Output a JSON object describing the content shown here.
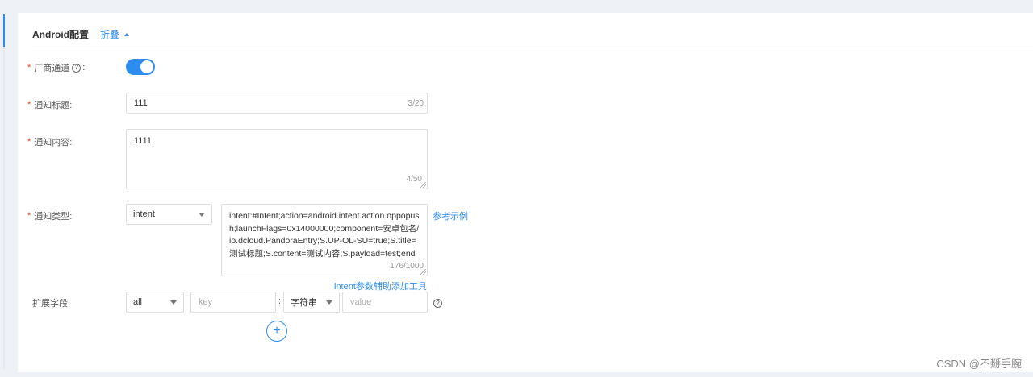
{
  "section": {
    "title": "Android配置",
    "collapse_label": "折叠"
  },
  "fields": {
    "vendor_channel": {
      "label": "厂商通道",
      "help": "?",
      "colon": ":",
      "enabled": true
    },
    "notify_title": {
      "label": "通知标题:",
      "value": "111",
      "counter": "3/20"
    },
    "notify_content": {
      "label": "通知内容:",
      "value": "1111",
      "counter": "4/50"
    },
    "notify_type": {
      "label": "通知类型:",
      "selected": "intent",
      "intent_value": "intent:#Intent;action=android.intent.action.oppopush;launchFlags=0x14000000;component=安卓包名/io.dcloud.PandoraEntry;S.UP-OL-SU=true;S.title=测试标题;S.content=测试内容;S.payload=test;end",
      "counter": "176/1000",
      "example_link": "参考示例",
      "helper_link": "intent参数辅助添加工具"
    },
    "extension": {
      "label": "扩展字段:",
      "scope": "all",
      "key_placeholder": "key",
      "separator": ":",
      "type": "字符串",
      "value_placeholder": "value",
      "help": "?",
      "add": "+"
    }
  },
  "watermark": "CSDN @不掰手腕",
  "colors": {
    "accent": "#2d8cf0",
    "required": "#ed4014",
    "border": "#dcdee2"
  }
}
